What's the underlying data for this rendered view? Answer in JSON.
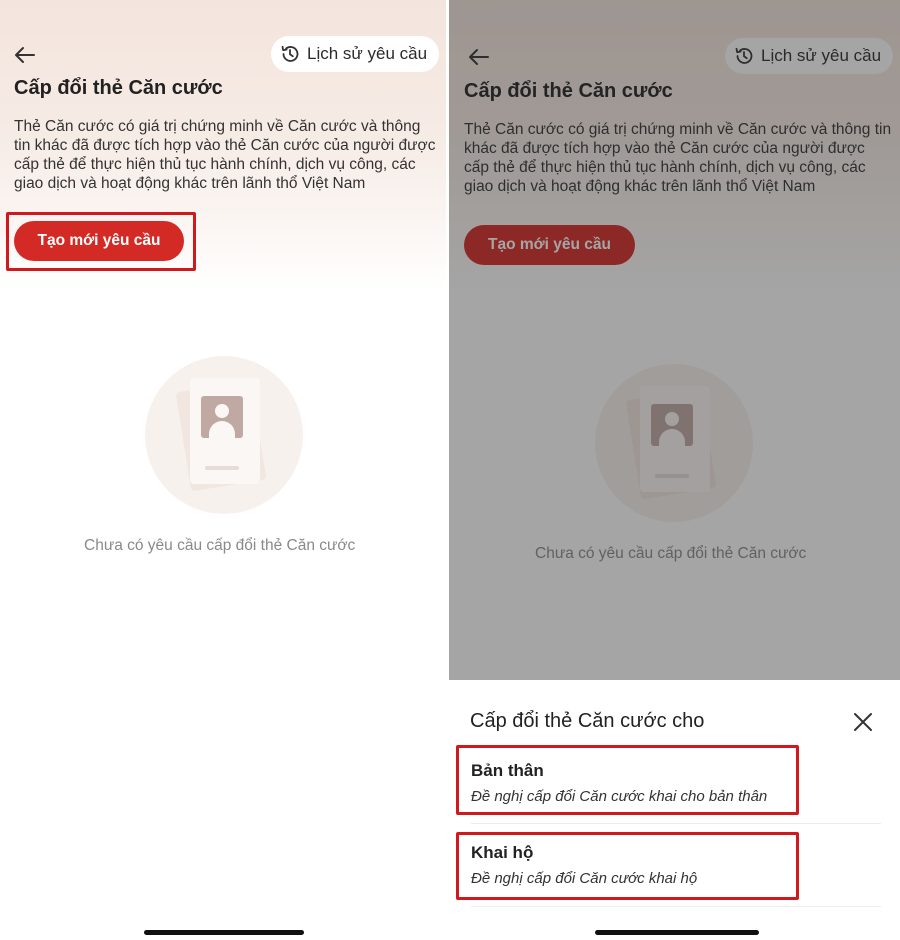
{
  "screen": {
    "back_icon": "arrow-left-icon",
    "history_button": {
      "icon": "history-clock-icon",
      "label": "Lịch sử yêu cầu"
    },
    "title": "Cấp đổi thẻ Căn cước",
    "description": "Thẻ Căn cước có giá trị chứng minh về Căn cước và thông tin khác đã được tích hợp vào thẻ Căn cước của người được cấp thẻ để thực hiện thủ tục hành chính, dịch vụ công, các giao dịch và hoạt động khác trên lãnh thổ Việt Nam",
    "create_button_label": "Tạo mới yêu cầu",
    "empty_state": {
      "icon": "id-card-illustration",
      "text": "Chưa có yêu cầu cấp đổi thẻ Căn cước"
    }
  },
  "bottom_sheet": {
    "title": "Cấp đổi thẻ Căn cước cho",
    "close_icon": "close-icon",
    "options": [
      {
        "title": "Bản thân",
        "subtitle": "Đề nghị cấp đổi Căn cước khai cho bản thân"
      },
      {
        "title": "Khai hộ",
        "subtitle": "Đề nghị cấp đổi Căn cước khai hộ"
      }
    ]
  },
  "colors": {
    "accent": "#d42a26",
    "highlight_border": "#d0181d",
    "header_gradient_top": "#f3e5dd",
    "overlay": "rgba(40,40,40,0.42)"
  }
}
